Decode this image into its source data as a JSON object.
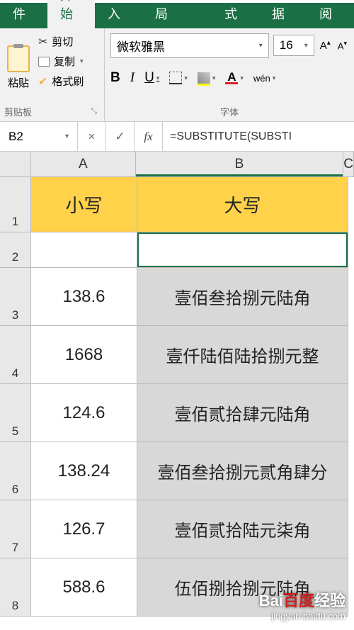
{
  "tabs": {
    "file": "文件",
    "home": "开始",
    "insert": "插入",
    "page_layout": "页面布局",
    "formulas": "公式",
    "data": "数据",
    "review": "审阅"
  },
  "clipboard": {
    "paste": "粘贴",
    "cut": "剪切",
    "copy": "复制",
    "format_painter": "格式刷",
    "group_label": "剪贴板"
  },
  "font": {
    "name": "微软雅黑",
    "size": "16",
    "grow": "A",
    "shrink": "A",
    "bold": "B",
    "italic": "I",
    "underline": "U",
    "wen": "wén",
    "group_label": "字体"
  },
  "formula_bar": {
    "name_box": "B2",
    "cancel": "×",
    "confirm": "✓",
    "fx": "fx",
    "formula": "=SUBSTITUTE(SUBSTI"
  },
  "columns": {
    "a": "A",
    "b": "B",
    "c": "C"
  },
  "rows": [
    "1",
    "2",
    "3",
    "4",
    "5",
    "6",
    "7",
    "8"
  ],
  "headers": {
    "col_a": "小写",
    "col_b": "大写"
  },
  "data": [
    {
      "a": "138.6",
      "b": "壹佰叁拾捌元陆角"
    },
    {
      "a": "1668",
      "b": "壹仟陆佰陆拾捌元整"
    },
    {
      "a": "124.6",
      "b": "壹佰贰拾肆元陆角"
    },
    {
      "a": "138.24",
      "b": "壹佰叁拾捌元贰角肆分"
    },
    {
      "a": "126.7",
      "b": "壹佰贰拾陆元柒角"
    },
    {
      "a": "588.6",
      "b": "伍佰捌拾捌元陆角"
    }
  ],
  "watermark": {
    "brand_pre": "Bai",
    "brand_hi": "百度",
    "brand_post": "经验",
    "url": "jingyan.baidu.com"
  }
}
